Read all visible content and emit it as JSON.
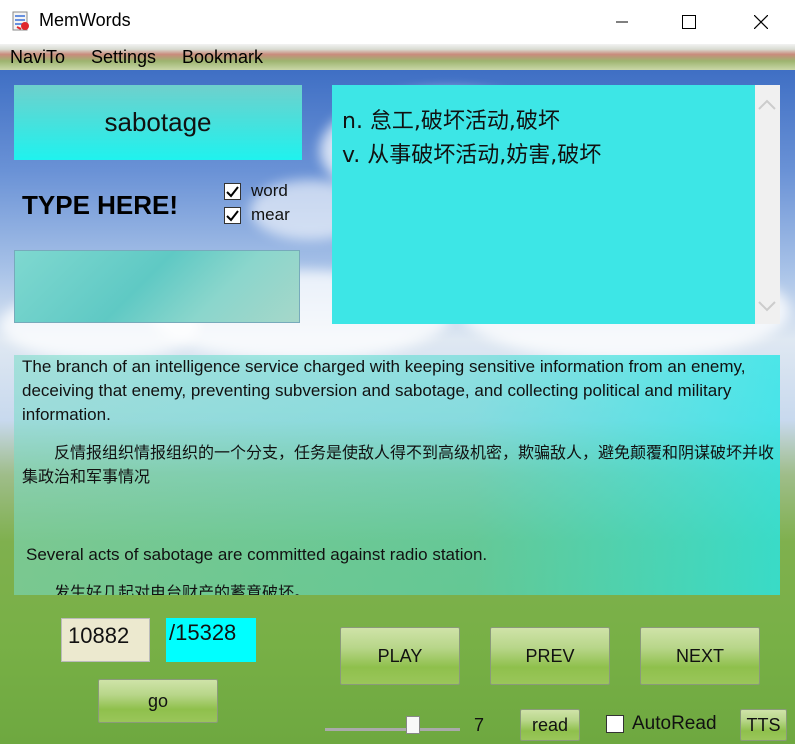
{
  "window": {
    "title": "MemWords",
    "minimize_icon": "minimize-icon",
    "maximize_icon": "maximize-icon",
    "close_icon": "close-icon"
  },
  "menu": {
    "items": [
      {
        "label": "NaviTo"
      },
      {
        "label": "Settings"
      },
      {
        "label": "Bookmark"
      }
    ]
  },
  "word": {
    "text": "sabotage"
  },
  "typing": {
    "prompt": "TYPE HERE!",
    "input_value": "",
    "options": [
      {
        "label": "word",
        "checked": true
      },
      {
        "label": "mear",
        "checked": true
      }
    ]
  },
  "meaning": {
    "lines": [
      "n. 怠工,破坏活动,破坏",
      "v. 从事破坏活动,妨害,破坏"
    ]
  },
  "examples": {
    "en1": " The branch of an intelligence service charged with keeping sensitive information from an enemy, deceiving that enemy, preventing subversion and sabotage, and collecting political and military information.",
    "zh1": "　　反情报组织情报组织的一个分支，任务是使敌人得不到高级机密，欺骗敌人，避免颠覆和阴谋破坏并收集政治和军事情况",
    "en2": " Several acts of sabotage are committed against radio station.",
    "zh2": "　　发生好几起对电台财产的蓄意破坏。"
  },
  "navigation": {
    "current": "10882",
    "total": "/15328",
    "go_label": "go",
    "play_label": "PLAY",
    "prev_label": "PREV",
    "next_label": "NEXT"
  },
  "playback": {
    "speed_value": "7",
    "speed_fraction": 0.6,
    "read_label": "read",
    "autoread_label": "AutoRead",
    "autoread_checked": false,
    "tts_label": "TTS"
  },
  "colors": {
    "word_box": "#3fe4e0",
    "meaning_box": "#3de6e6",
    "total_box": "#00ffff",
    "current_box": "#ece9cf"
  }
}
